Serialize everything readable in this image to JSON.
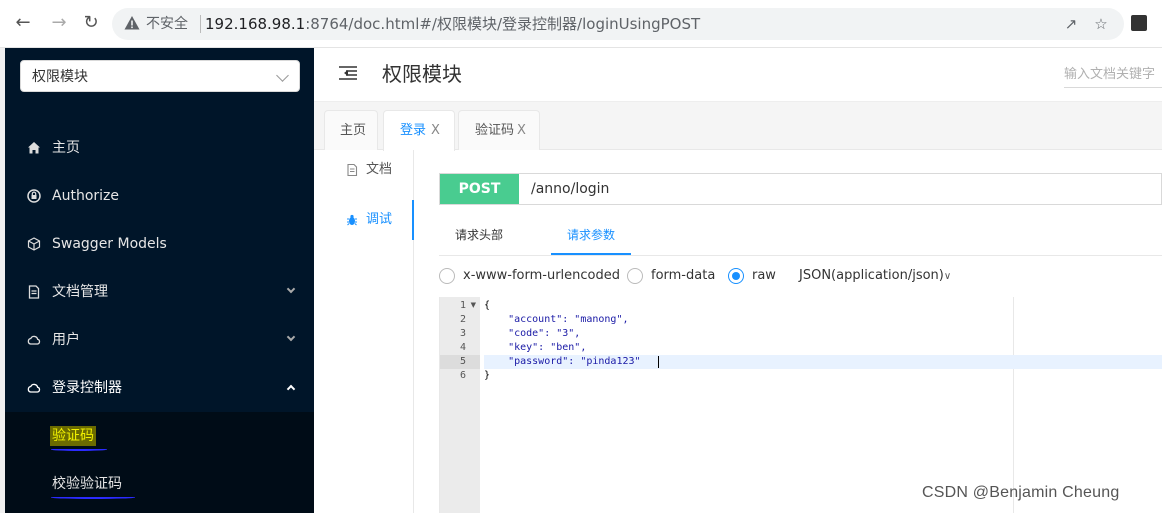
{
  "browser": {
    "not_secure": "不安全",
    "url_host": "192.168.98.1",
    "url_rest": ":8764/doc.html#/权限模块/登录控制器/loginUsingPOST"
  },
  "sidebar": {
    "module_select": "权限模块",
    "items": [
      {
        "label": "主页",
        "icon": "home-icon"
      },
      {
        "label": "Authorize",
        "icon": "lock-icon"
      },
      {
        "label": "Swagger Models",
        "icon": "cube-icon"
      },
      {
        "label": "文档管理",
        "icon": "document-icon"
      },
      {
        "label": "用户",
        "icon": "cloud-icon"
      },
      {
        "label": "登录控制器",
        "icon": "cloud-icon"
      }
    ],
    "subitems": [
      {
        "label": "验证码"
      },
      {
        "label": "校验验证码"
      }
    ]
  },
  "header": {
    "title": "权限模块",
    "search_placeholder": "输入文档关键字"
  },
  "tabs": [
    {
      "label": "主页"
    },
    {
      "label": "登录",
      "close": "X"
    },
    {
      "label": "验证码",
      "close": "X"
    }
  ],
  "doc_nav": [
    {
      "label": "文档",
      "icon": "document-icon"
    },
    {
      "label": "调试",
      "icon": "bug-icon"
    }
  ],
  "request": {
    "method": "POST",
    "path": "/anno/login"
  },
  "sub_tabs": [
    "请求头部",
    "请求参数"
  ],
  "body_types": {
    "options": [
      "x-www-form-urlencoded",
      "form-data",
      "raw"
    ],
    "selected": "raw",
    "content_type": "JSON(application/json)"
  },
  "editor": {
    "line_numbers": [
      "1",
      "2",
      "3",
      "4",
      "5",
      "6"
    ],
    "lines": [
      "{",
      "    \"account\": \"manong\",",
      "    \"code\": \"3\",",
      "    \"key\": \"ben\",",
      "    \"password\": \"pinda123\"",
      "}"
    ]
  },
  "watermark": "CSDN @Benjamin Cheung",
  "colors": {
    "sidebar_bg": "#001529",
    "accent": "#1890ff",
    "post_green": "#49cc90"
  }
}
